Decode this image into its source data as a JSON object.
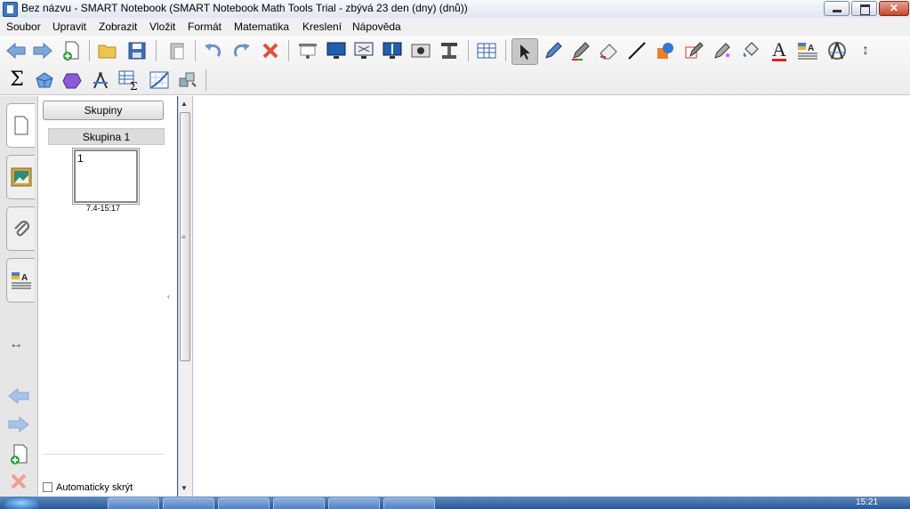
{
  "window": {
    "title": "Bez názvu - SMART Notebook (SMART Notebook Math Tools Trial - zbývá 23 den (dny) (dnů))"
  },
  "menu": [
    "Soubor",
    "Upravit",
    "Zobrazit",
    "Vložit",
    "Formát",
    "Matematika",
    "Kreslení",
    "Nápověda"
  ],
  "toolbar": {
    "row1_icons": [
      "back-arrow",
      "forward-arrow",
      "add-page",
      "open-file",
      "save",
      "paste",
      "undo",
      "redo",
      "delete",
      "screen-shade",
      "full-screen",
      "transparent-background",
      "dual-page",
      "screen-capture",
      "document-camera",
      "table",
      "select",
      "pen",
      "creative-pen",
      "eraser",
      "line",
      "shapes",
      "magic-pen",
      "shape-recognition-pen",
      "fill",
      "text",
      "properties",
      "measurement-tools",
      "move-toolbar"
    ],
    "row2_icons": [
      "sigma",
      "shape-3d",
      "polygon",
      "compass",
      "table-sum",
      "graph",
      "tools"
    ],
    "text_glyph": "A",
    "sigma_glyph": "Σ"
  },
  "sidebar": {
    "tabs": [
      "page-sorter",
      "gallery",
      "attachments",
      "properties"
    ],
    "groups_button": "Skupiny",
    "group_name": "Skupina 1",
    "thumbnail": {
      "number": "1",
      "label": "7.4-15:17"
    },
    "autohide_label": "Automaticky skrýt"
  },
  "taskbar": {
    "clock": "15:21"
  },
  "colors": {
    "accent": "#3c5ab4",
    "close_button": "#c7462f"
  }
}
